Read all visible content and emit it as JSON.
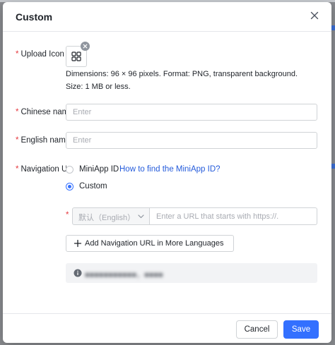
{
  "dialog": {
    "title": "Custom",
    "upload_icon": {
      "label": "Upload Icon",
      "hint_line1": "Dimensions: 96 × 96 pixels. Format: PNG, transparent background.",
      "hint_line2": "Size: 1 MB or less."
    },
    "chinese_name": {
      "label": "Chinese name",
      "placeholder": "Enter",
      "value": ""
    },
    "english_name": {
      "label": "English name",
      "placeholder": "Enter",
      "value": ""
    },
    "navigation": {
      "label": "Navigation URL",
      "options": [
        {
          "label": "MiniApp ID",
          "selected": false
        },
        {
          "label": "Custom",
          "selected": true
        }
      ],
      "help_link": "How to find the MiniApp ID?",
      "language_select": "默认（English）",
      "url_placeholder": "Enter a URL that starts with https://.",
      "add_button": "Add Navigation URL in More Languages",
      "notice_text": "■■■■■■■■■■■，■■■■"
    },
    "footer": {
      "cancel": "Cancel",
      "save": "Save"
    }
  },
  "colors": {
    "primary": "#3370ff",
    "link": "#245bdb",
    "required": "#e5393f"
  }
}
